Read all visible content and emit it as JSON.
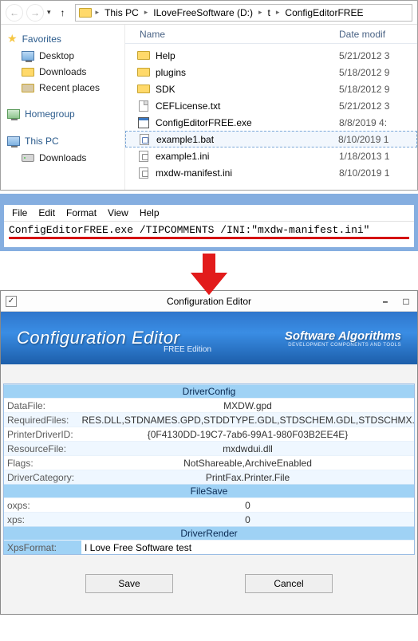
{
  "explorer": {
    "breadcrumbs": [
      "This PC",
      "ILoveFreeSoftware (D:)",
      "t",
      "ConfigEditorFREE"
    ],
    "columns": {
      "name": "Name",
      "date": "Date modif"
    },
    "sidebar": {
      "favorites": {
        "label": "Favorites",
        "items": [
          "Desktop",
          "Downloads",
          "Recent places"
        ]
      },
      "homegroup": {
        "label": "Homegroup"
      },
      "thispc": {
        "label": "This PC",
        "items": [
          "Downloads"
        ]
      }
    },
    "files": [
      {
        "name": "Help",
        "date": "5/21/2012 3",
        "type": "folder"
      },
      {
        "name": "plugins",
        "date": "5/18/2012 9",
        "type": "folder"
      },
      {
        "name": "SDK",
        "date": "5/18/2012 9",
        "type": "folder"
      },
      {
        "name": "CEFLicense.txt",
        "date": "5/21/2012 3",
        "type": "doc"
      },
      {
        "name": "ConfigEditorFREE.exe",
        "date": "8/8/2019 4:",
        "type": "exe"
      },
      {
        "name": "example1.bat",
        "date": "8/10/2019 1",
        "type": "bat",
        "selected": true
      },
      {
        "name": "example1.ini",
        "date": "1/18/2013 1",
        "type": "ini"
      },
      {
        "name": "mxdw-manifest.ini",
        "date": "8/10/2019 1",
        "type": "ini"
      }
    ]
  },
  "notepad": {
    "menu": [
      "File",
      "Edit",
      "Format",
      "View",
      "Help"
    ],
    "content": "ConfigEditorFREE.exe /TIPCOMMENTS /INI:\"mxdw-manifest.ini\""
  },
  "cfg": {
    "title": "Configuration Editor",
    "banner_title": "Configuration Editor",
    "banner_subtitle": "FREE Edition",
    "brand": {
      "line1": "Software Algorithms",
      "line2": "DEVELOPMENT COMPONENTS AND TOOLS"
    },
    "sections": [
      {
        "name": "DriverConfig",
        "rows": [
          {
            "k": "DataFile:",
            "v": "MXDW.gpd"
          },
          {
            "k": "RequiredFiles:",
            "v": "UNIRES.DLL,STDNAMES.GPD,STDDTYPE.GDL,STDSCHEM.GDL,STDSCHMX.G..."
          },
          {
            "k": "PrinterDriverID:",
            "v": "{0F4130DD-19C7-7ab6-99A1-980F03B2EE4E}"
          },
          {
            "k": "ResourceFile:",
            "v": "mxdwdui.dll"
          },
          {
            "k": "Flags:",
            "v": "NotShareable,ArchiveEnabled"
          },
          {
            "k": "DriverCategory:",
            "v": "PrintFax.Printer.File"
          }
        ]
      },
      {
        "name": "FileSave",
        "rows": [
          {
            "k": "oxps:",
            "v": "0"
          },
          {
            "k": "xps:",
            "v": "0"
          }
        ]
      },
      {
        "name": "DriverRender",
        "rows": [
          {
            "k": "XpsFormat:",
            "v": "I Love Free Software test",
            "edit": true
          }
        ]
      }
    ],
    "buttons": {
      "save": "Save",
      "cancel": "Cancel"
    }
  }
}
